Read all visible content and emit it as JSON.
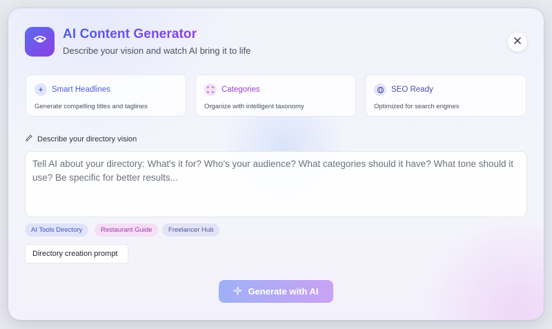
{
  "header": {
    "title": "AI Content Generator",
    "subtitle": "Describe your vision and watch AI bring it to life",
    "logo_icon": "eye-icon",
    "close_icon": "close-icon"
  },
  "features": [
    {
      "icon": "sparkle-icon",
      "title": "Smart Headlines",
      "description": "Generate compelling titles and taglines",
      "color": "#4a5be0"
    },
    {
      "icon": "grid-icon",
      "title": "Categories",
      "description": "Organize with intelligent taxonomy",
      "color": "#9b3fc9"
    },
    {
      "icon": "globe-icon",
      "title": "SEO Ready",
      "description": "Optimized for search engines",
      "color": "#4b4fa8"
    }
  ],
  "prompt": {
    "label": "Describe your directory vision",
    "label_icon": "pencil-icon",
    "placeholder": "Tell AI about your directory: What's it for? Who's your audience? What categories should it have? What tone should it use? Be specific for better results...",
    "value": ""
  },
  "chips": [
    "AI Tools Directory",
    "Restaurant Guide",
    "Freelancer Hub"
  ],
  "tooltip": "Directory creation prompt",
  "generate": {
    "label": "Generate with AI",
    "icon": "sparkle-icon"
  },
  "colors": {
    "accent_start": "#5b6cf0",
    "accent_end": "#8b3fe6",
    "button_start": "#9eb0f7",
    "button_end": "#c9a2f3"
  }
}
